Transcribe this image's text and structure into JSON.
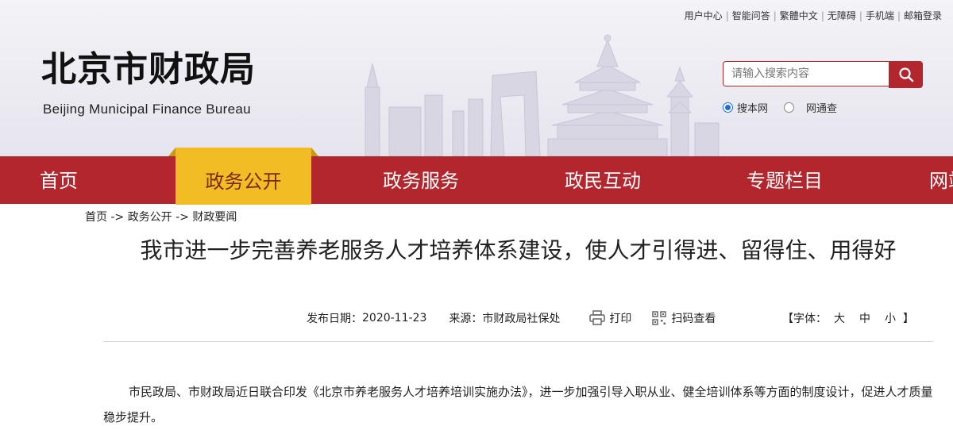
{
  "top_links": [
    "用户中心",
    "智能问答",
    "繁體中文",
    "无障碍",
    "手机端",
    "邮箱登录"
  ],
  "logo": {
    "cn": "北京市财政局",
    "en": "Beijing Municipal Finance Bureau"
  },
  "search": {
    "placeholder": "请输入搜索内容",
    "scope_site": "搜本网",
    "scope_network": "网通查",
    "selected_scope": "搜本网"
  },
  "nav": {
    "items": [
      "首页",
      "政务公开",
      "政务服务",
      "政民互动",
      "专题栏目",
      "网站"
    ],
    "active": "政务公开"
  },
  "breadcrumb": [
    "首页",
    "政务公开",
    "财政要闻"
  ],
  "breadcrumb_sep": " -> ",
  "article": {
    "title": "我市进一步完善养老服务人才培养体系建设，使人才引得进、留得住、用得好",
    "date_label": "发布日期：",
    "date": "2020-11-23",
    "source_label": "来源：",
    "source": "市财政局社保处",
    "print_label": "打印",
    "qr_label": "扫码查看",
    "font_label": "【字体：",
    "font_sizes": [
      "大",
      "中",
      "小"
    ],
    "font_end": "】",
    "body": "市民政局、市财政局近日联合印发《北京市养老服务人才培养培训实施办法》，进一步加强引导入职从业、健全培训体系等方面的制度设计，促进人才质量稳步提升。"
  },
  "colors": {
    "brand_red": "#b3262d",
    "active_gold": "#f2bd24",
    "header_bg": "#ecebf2"
  }
}
